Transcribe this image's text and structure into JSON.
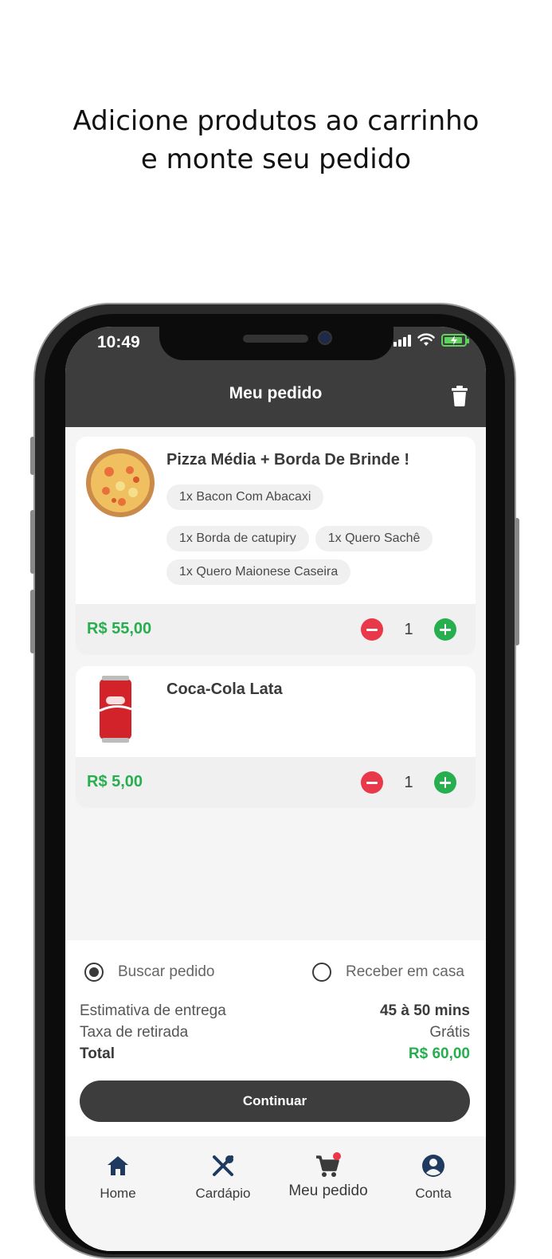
{
  "headline": {
    "line1": "Adicione produtos ao carrinho",
    "line2": "e monte seu pedido"
  },
  "status_bar": {
    "time": "10:49",
    "icons": [
      "signal-icon",
      "wifi-icon",
      "battery-charging-icon"
    ]
  },
  "header": {
    "title": "Meu pedido",
    "action_icon": "trash-icon"
  },
  "cart_items": [
    {
      "name": "Pizza Média + Borda De Brinde !",
      "image": "pizza-image",
      "options": [
        "1x  Bacon Com Abacaxi",
        "1x  Borda de catupiry",
        "1x  Quero Sachê",
        "1x  Quero Maionese Caseira"
      ],
      "price": "R$ 55,00",
      "quantity": "1"
    },
    {
      "name": "Coca-Cola Lata",
      "image": "soda-can-image",
      "options": [],
      "price": "R$ 5,00",
      "quantity": "1"
    }
  ],
  "delivery_options": {
    "pickup": "Buscar pedido",
    "delivery": "Receber em casa",
    "selected": "pickup"
  },
  "summary": {
    "estimate_label": "Estimativa de entrega",
    "estimate_value": "45 à 50 mins",
    "fee_label": "Taxa de retirada",
    "fee_value": "Grátis",
    "total_label": "Total",
    "total_value": "R$ 60,00"
  },
  "continue_label": "Continuar",
  "tabbar": [
    {
      "label": "Home",
      "icon": "home-icon"
    },
    {
      "label": "Cardápio",
      "icon": "utensils-icon"
    },
    {
      "label": "Meu pedido",
      "icon": "cart-icon",
      "active": true
    },
    {
      "label": "Conta",
      "icon": "user-icon"
    }
  ],
  "colors": {
    "header": "#3d3d3d",
    "price_green": "#27ae4e",
    "minus_red": "#e8384a",
    "badge_red": "#e8384a"
  }
}
